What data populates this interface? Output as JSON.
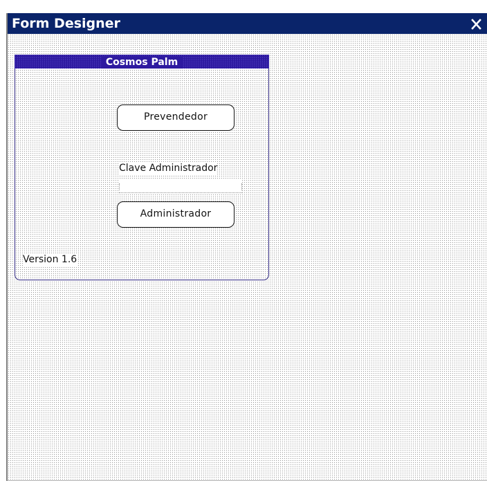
{
  "window": {
    "title": "Form Designer",
    "close_icon": "close-icon"
  },
  "colors": {
    "titlebar_background": "#0a246a",
    "form_titlebar_background": "#2e1aa0",
    "canvas_dots": "#9a9a9a"
  },
  "form": {
    "title": "Cosmos Palm",
    "prevendedor_button_label": "Prevendedor",
    "clave_label": "Clave Administrador",
    "clave_field_value": "",
    "administrador_button_label": "Administrador",
    "version_label": "Version 1.6"
  }
}
